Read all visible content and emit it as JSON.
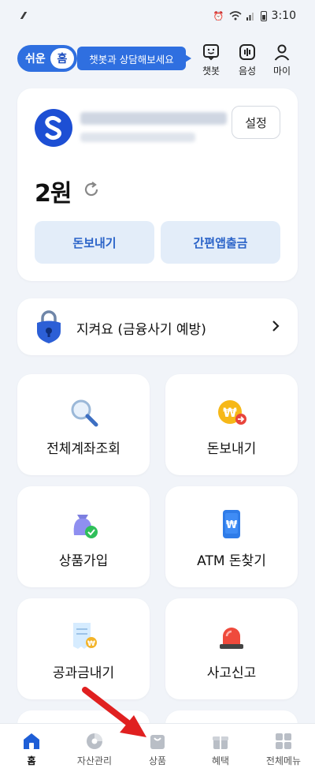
{
  "status_bar": {
    "time": "3:10"
  },
  "header": {
    "mode_label": "쉬운",
    "mode_knob": "홈",
    "chatbot_bubble": "챗봇과 상담해보세요",
    "buttons": [
      {
        "label": "챗봇",
        "icon": "chatbot-icon"
      },
      {
        "label": "음성",
        "icon": "voice-icon"
      },
      {
        "label": "마이",
        "icon": "person-icon"
      }
    ]
  },
  "account": {
    "settings_label": "설정",
    "balance": "2원",
    "send_label": "돈보내기",
    "app_withdraw_label": "간편앱출금"
  },
  "security_banner": {
    "text": "지켜요 (금융사기 예방)",
    "icon": "lock-shield-icon"
  },
  "tiles": [
    {
      "label": "전체계좌조회",
      "icon": "magnifier-icon"
    },
    {
      "label": "돈보내기",
      "icon": "coin-send-icon"
    },
    {
      "label": "상품가입",
      "icon": "money-bag-icon"
    },
    {
      "label": "ATM 돈찾기",
      "icon": "phone-won-icon"
    },
    {
      "label": "공과금내기",
      "icon": "receipt-icon"
    },
    {
      "label": "사고신고",
      "icon": "siren-icon"
    }
  ],
  "bottom_nav": [
    {
      "label": "홈",
      "icon": "home-icon",
      "active": true
    },
    {
      "label": "자산관리",
      "icon": "pie-chart-icon",
      "active": false
    },
    {
      "label": "상품",
      "icon": "bag-icon",
      "active": false
    },
    {
      "label": "혜택",
      "icon": "gift-icon",
      "active": false
    },
    {
      "label": "전체메뉴",
      "icon": "grid-menu-icon",
      "active": false
    }
  ],
  "colors": {
    "brand_blue": "#2f6fe0",
    "background": "#f1f4f9",
    "button_bg": "#e3edf9",
    "annotation_red": "#e02020"
  }
}
